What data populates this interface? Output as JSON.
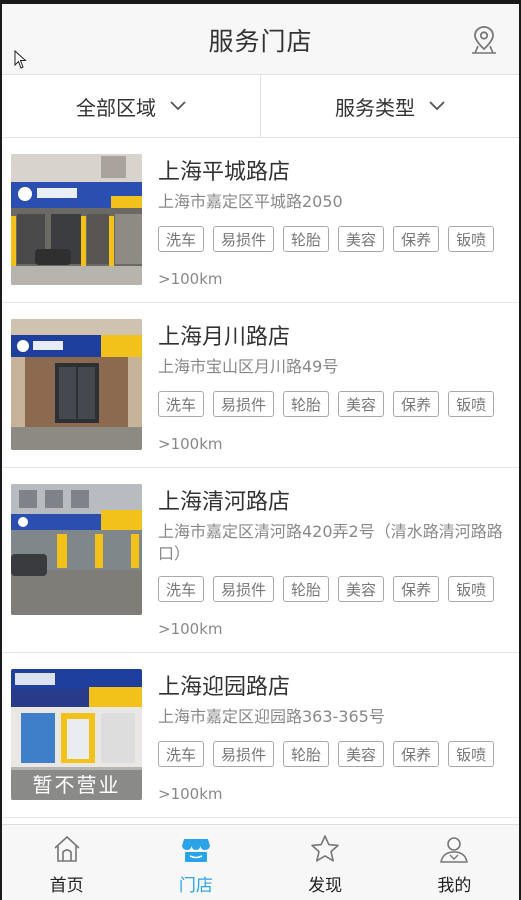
{
  "header": {
    "title": "服务门店"
  },
  "filters": {
    "region": "全部区域",
    "service_type": "服务类型"
  },
  "stores": [
    {
      "name": "上海平城路店",
      "address": "上海市嘉定区平城路2050",
      "distance": ">100km",
      "tags": [
        "洗车",
        "易损件",
        "轮胎",
        "美容",
        "保养",
        "钣喷"
      ]
    },
    {
      "name": "上海月川路店",
      "address": "上海市宝山区月川路49号",
      "distance": ">100km",
      "tags": [
        "洗车",
        "易损件",
        "轮胎",
        "美容",
        "保养",
        "钣喷"
      ]
    },
    {
      "name": "上海清河路店",
      "address": "上海市嘉定区清河路420弄2号（清水路清河路路口）",
      "distance": ">100km",
      "tags": [
        "洗车",
        "易损件",
        "轮胎",
        "美容",
        "保养",
        "钣喷"
      ]
    },
    {
      "name": "上海迎园路店",
      "address": "上海市嘉定区迎园路363-365号",
      "distance": ">100km",
      "tags": [
        "洗车",
        "易损件",
        "轮胎",
        "美容",
        "保养",
        "钣喷"
      ],
      "status": "暂不营业"
    }
  ],
  "tabbar": {
    "items": [
      {
        "label": "首页",
        "icon": "home-icon"
      },
      {
        "label": "门店",
        "icon": "store-icon",
        "active": true
      },
      {
        "label": "发现",
        "icon": "star-icon"
      },
      {
        "label": "我的",
        "icon": "user-icon"
      }
    ]
  },
  "colors": {
    "accent": "#2aa3e8",
    "brand_blue": "#2a4fb0",
    "brand_yellow": "#f2c21a"
  }
}
